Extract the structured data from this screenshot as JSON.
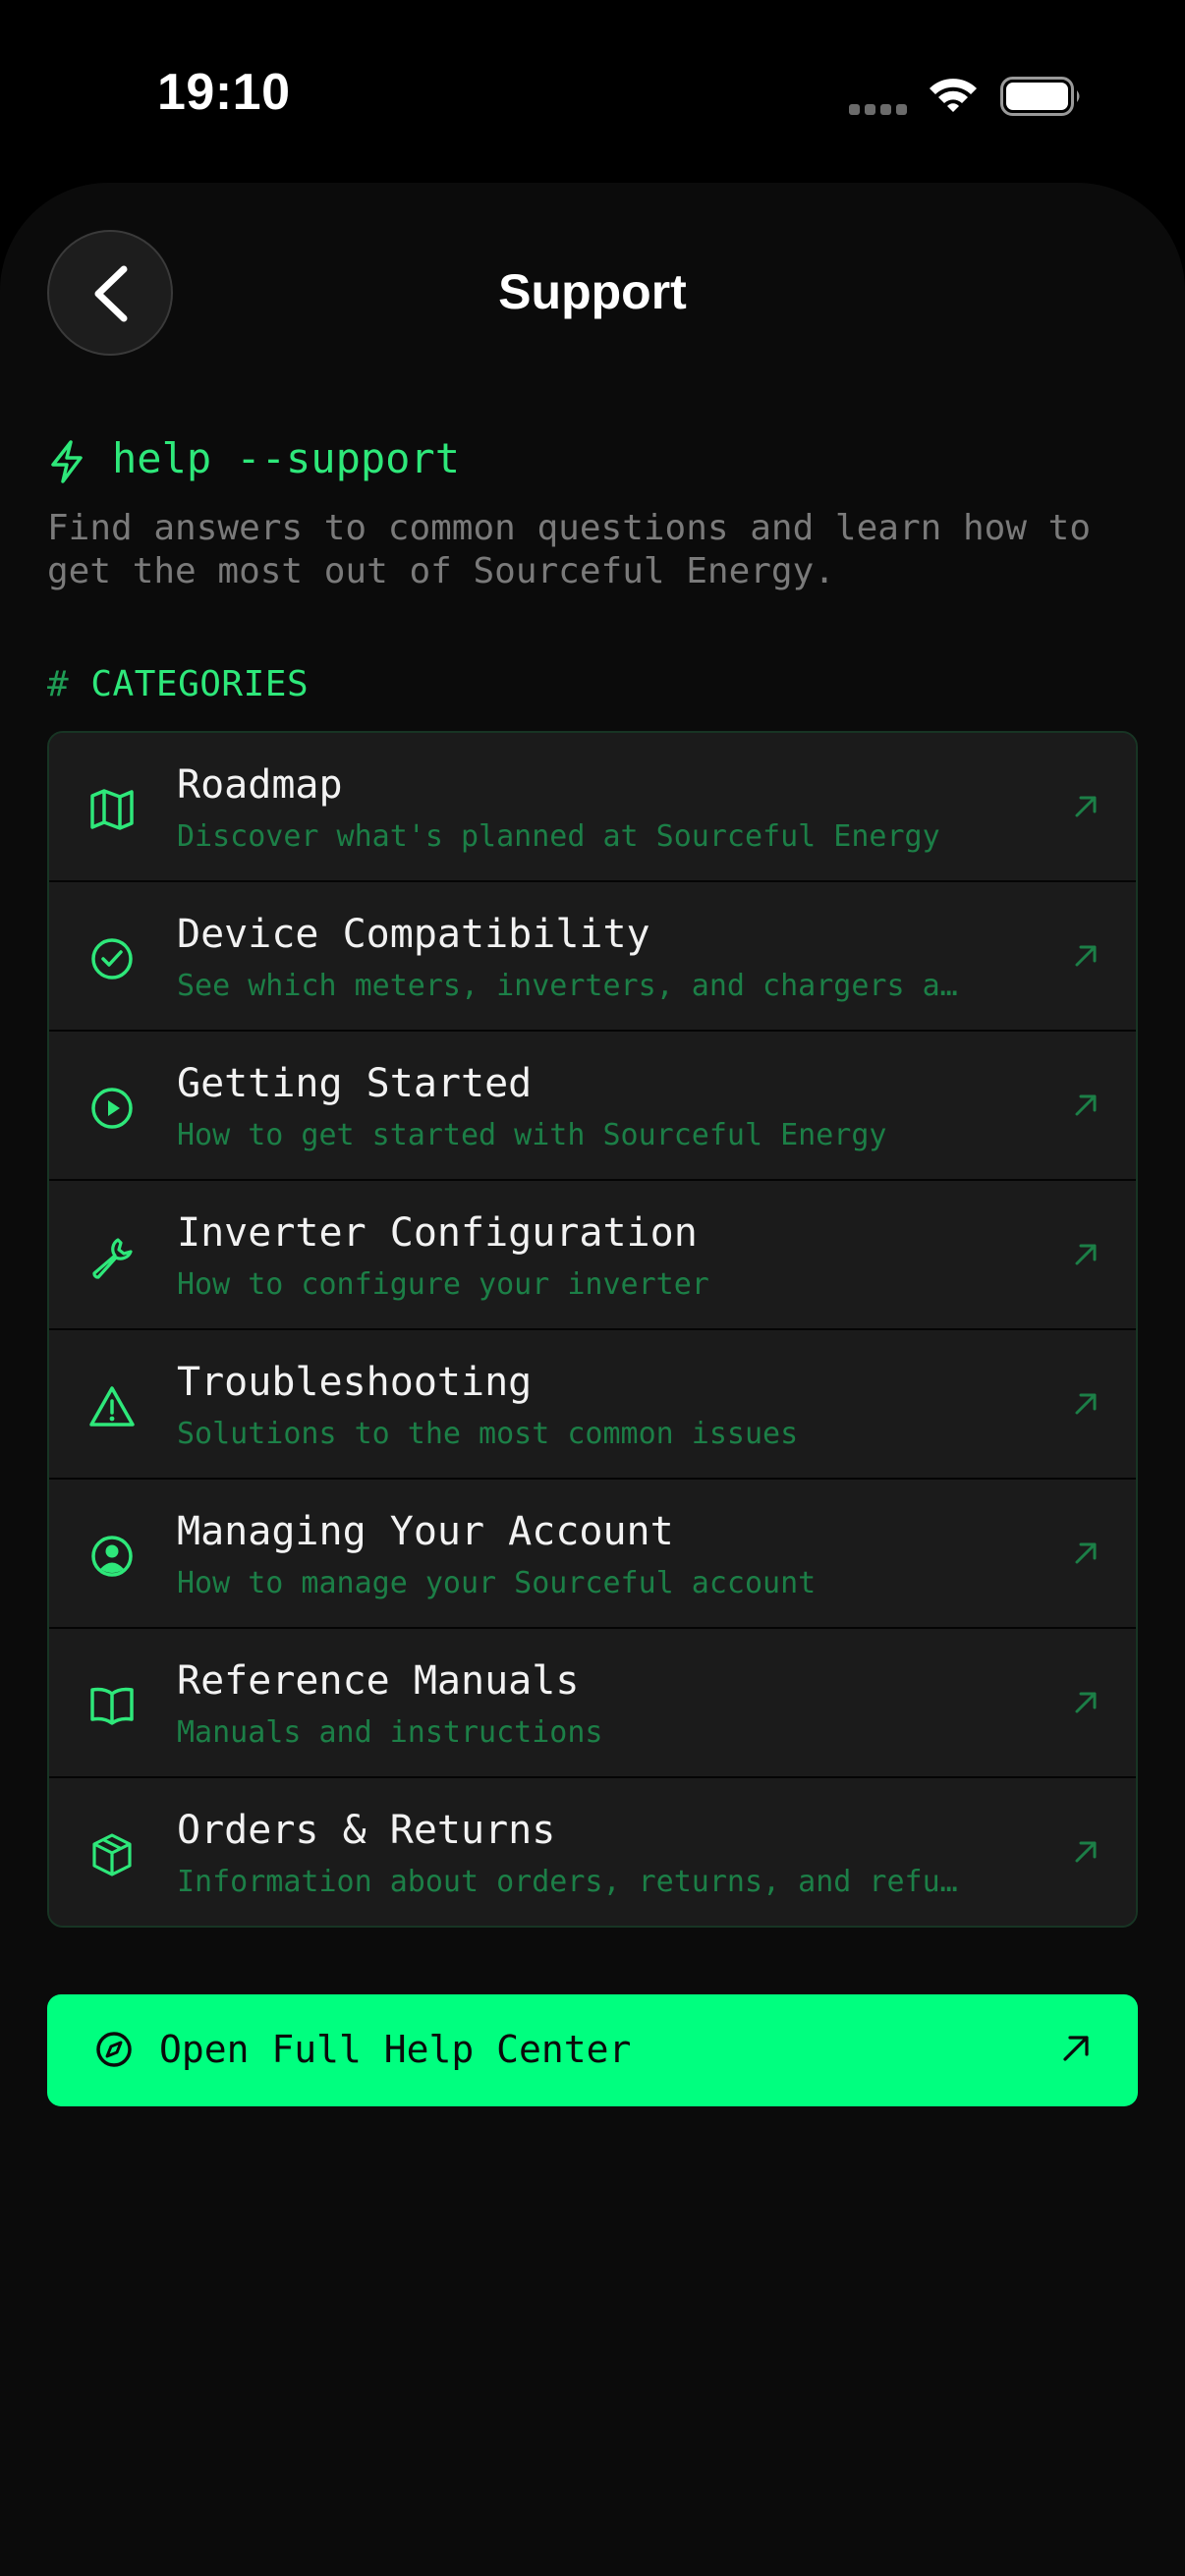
{
  "status_bar": {
    "time": "19:10"
  },
  "nav": {
    "title": "Support"
  },
  "header": {
    "command": "help --support",
    "intro": "Find answers to common questions and learn how to\nget the most out of Sourceful Energy."
  },
  "section": {
    "hash": "#",
    "label": "CATEGORIES"
  },
  "categories": [
    {
      "icon": "map-icon",
      "title": "Roadmap",
      "subtitle": "Discover what's planned at Sourceful Energy"
    },
    {
      "icon": "check-circle-icon",
      "title": "Device Compatibility",
      "subtitle": "See which meters, inverters, and chargers a…"
    },
    {
      "icon": "play-circle-icon",
      "title": "Getting Started",
      "subtitle": "How to get started with Sourceful Energy"
    },
    {
      "icon": "wrench-icon",
      "title": "Inverter Configuration",
      "subtitle": "How to configure your inverter"
    },
    {
      "icon": "warning-triangle-icon",
      "title": "Troubleshooting",
      "subtitle": "Solutions to the most common issues"
    },
    {
      "icon": "user-circle-icon",
      "title": "Managing Your Account",
      "subtitle": "How to manage your Sourceful account"
    },
    {
      "icon": "book-icon",
      "title": "Reference Manuals",
      "subtitle": "Manuals and instructions"
    },
    {
      "icon": "box-icon",
      "title": "Orders & Returns",
      "subtitle": "Information about orders, returns, and refu…"
    }
  ],
  "cta": {
    "icon": "compass-icon",
    "label": "Open Full Help Center"
  },
  "colors": {
    "accent": "#00ff7f",
    "accent_text": "#2ee87a",
    "subtitle": "#1c7f47",
    "background": "#0b0b0b",
    "row": "#1b1b1b"
  }
}
